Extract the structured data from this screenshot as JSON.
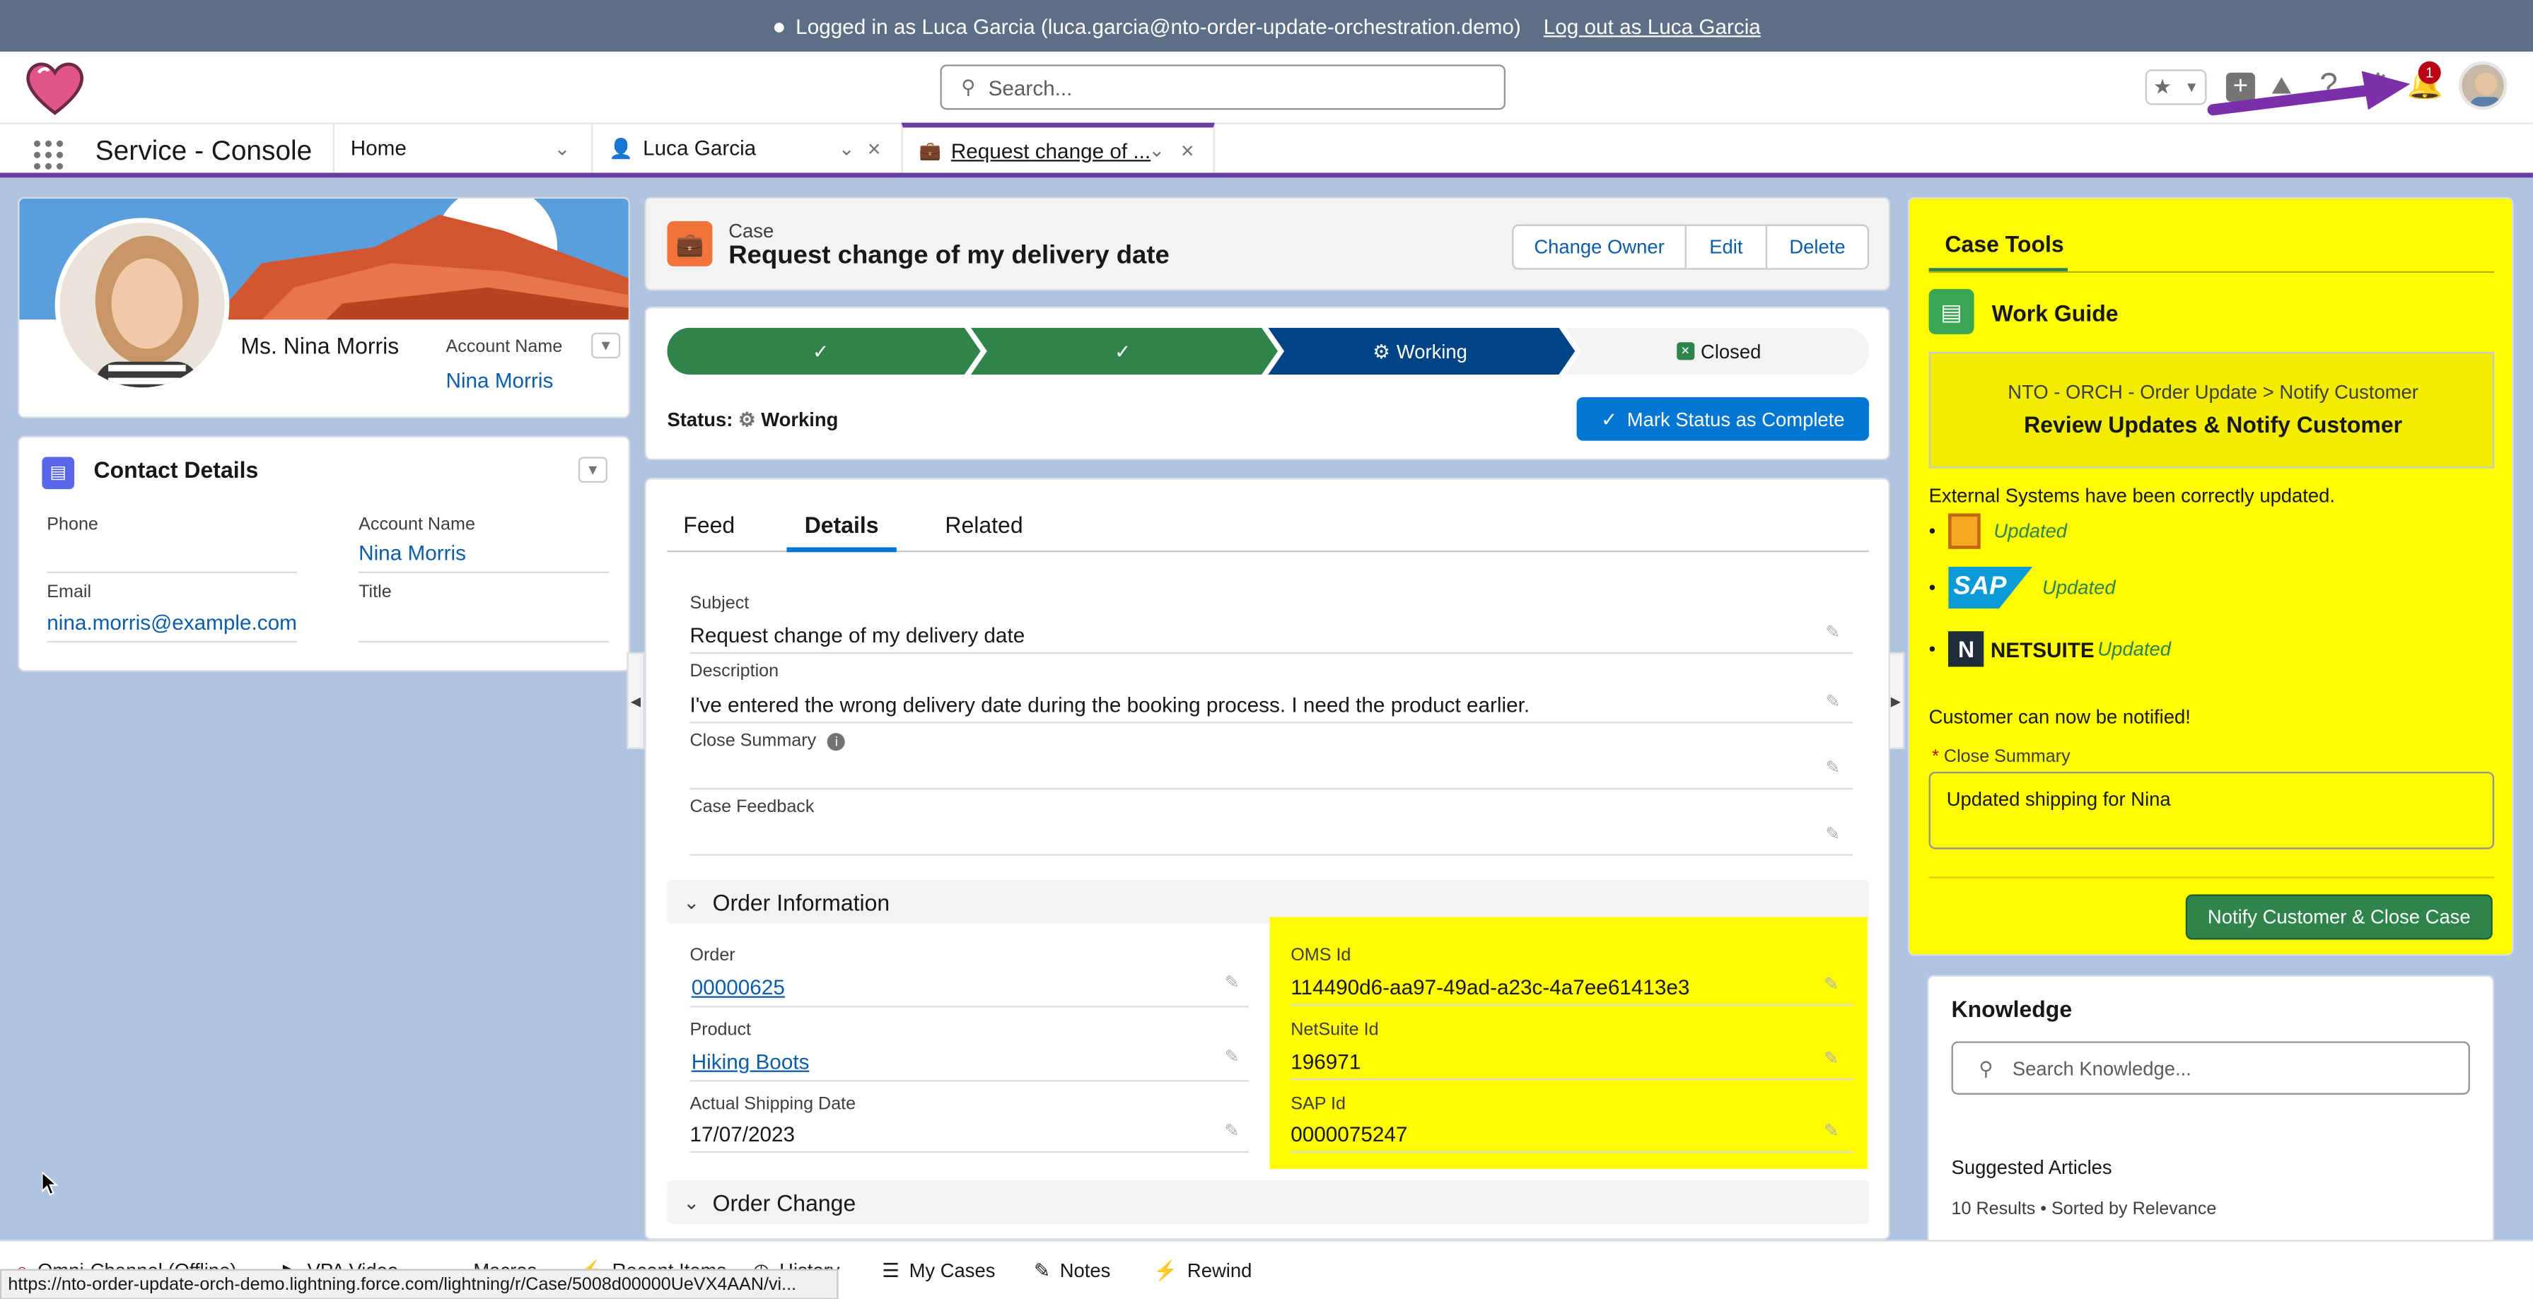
{
  "banner": {
    "logged_in_text": "Logged in as Luca Garcia (luca.garcia@nto-order-update-orchestration.demo)",
    "logout_link": "Log out as Luca Garcia"
  },
  "header": {
    "search_placeholder": "Search...",
    "notification_count": "1"
  },
  "nav": {
    "app_name": "Service - Console",
    "home_tab": "Home",
    "tabs": [
      {
        "label": "Luca Garcia"
      },
      {
        "label": "Request change of ..."
      }
    ]
  },
  "profile": {
    "name": "Ms. Nina Morris",
    "account_label": "Account Name",
    "account_value": "Nina Morris"
  },
  "contact": {
    "title": "Contact Details",
    "phone_label": "Phone",
    "phone_value": "",
    "account_label": "Account Name",
    "account_value": "Nina Morris",
    "email_label": "Email",
    "email_value": "nina.morris@example.com",
    "title_label": "Title",
    "title_value": ""
  },
  "case_header": {
    "type": "Case",
    "title": "Request change of my delivery date",
    "buttons": [
      "Change Owner",
      "Edit",
      "Delete"
    ]
  },
  "path": {
    "steps": [
      "",
      "",
      "Working",
      "Closed"
    ],
    "status_label": "Status:",
    "status_value": "Working",
    "mark_complete": "Mark Status as Complete"
  },
  "detail_tabs": [
    "Feed",
    "Details",
    "Related"
  ],
  "details": {
    "subject_label": "Subject",
    "subject_value": "Request change of my delivery date",
    "description_label": "Description",
    "description_value": "I've entered the wrong delivery date during the booking process. I need the product earlier.",
    "close_summary_label": "Close Summary",
    "case_feedback_label": "Case Feedback"
  },
  "order_info": {
    "section_title": "Order Information",
    "order_label": "Order",
    "order_value": "00000625",
    "product_label": "Product",
    "product_value": "Hiking Boots",
    "ship_label": "Actual Shipping Date",
    "ship_value": "17/07/2023",
    "oms_label": "OMS Id",
    "oms_value": "114490d6-aa97-49ad-a23c-4a7ee61413e3",
    "netsuite_label": "NetSuite Id",
    "netsuite_value": "196971",
    "sap_label": "SAP Id",
    "sap_value": "0000075247"
  },
  "order_change": {
    "section_title": "Order Change"
  },
  "case_tools": {
    "title": "Case Tools",
    "work_guide": "Work Guide",
    "breadcrumb": "NTO - ORCH - Order Update > Notify Customer",
    "step_title": "Review Updates & Notify Customer",
    "external_text": "External Systems have been correctly updated.",
    "systems": [
      {
        "name": "",
        "status": "Updated"
      },
      {
        "name": "SAP",
        "status": "Updated"
      },
      {
        "name": "NETSUITE",
        "status": "Updated"
      }
    ],
    "notify_text": "Customer can now be notified!",
    "close_summary_label": "Close Summary",
    "close_summary_value": "Updated shipping for Nina",
    "notify_button": "Notify Customer & Close Case"
  },
  "knowledge": {
    "title": "Knowledge",
    "search_placeholder": "Search Knowledge...",
    "suggested": "Suggested Articles",
    "results": "10 Results • Sorted by Relevance"
  },
  "utility_bar": {
    "items": [
      "Omni-Channel (Offline)",
      "VPA Video",
      "Macros",
      "Recent Items",
      "History",
      "My Cases",
      "Notes",
      "Rewind"
    ],
    "status_url": "https://nto-order-update-orch-demo.lightning.force.com/lightning/r/Case/5008d00000UeVX4AAN/vi..."
  },
  "colors": {
    "purple_accent": "#6a3ea1",
    "path_complete": "#2e844a",
    "path_current": "#014486",
    "brand_blue": "#0176d3",
    "highlight_yellow": "#fffb00",
    "notify_green": "#2e844a"
  }
}
